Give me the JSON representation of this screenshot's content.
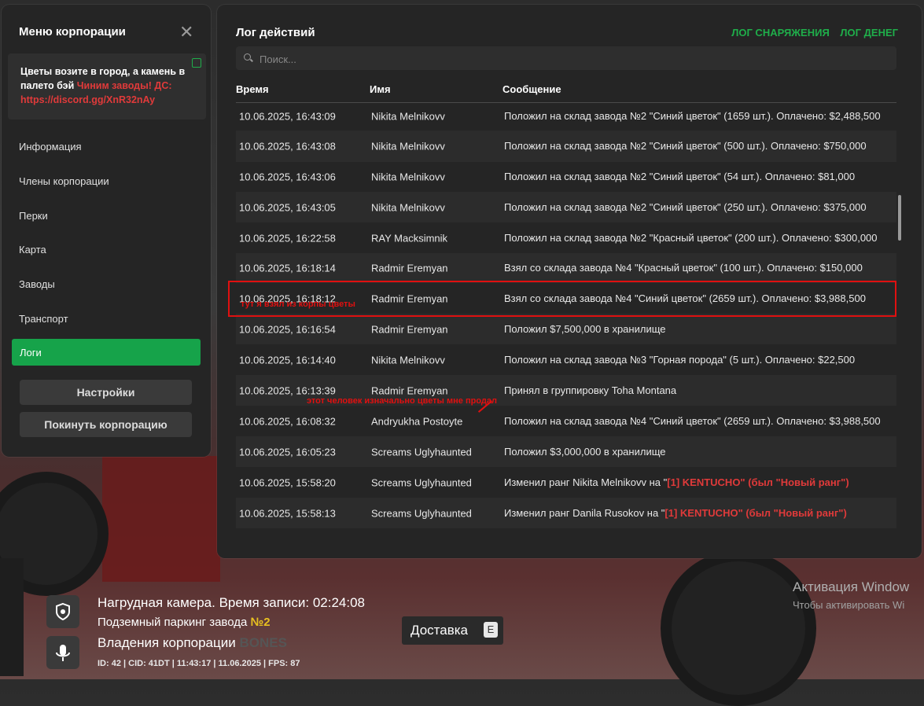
{
  "sidebar": {
    "title": "Меню корпорации",
    "notice": {
      "text": "Цветы возите в город, а камень в палето бэй",
      "red_text": "Чиним заводы! ДС: https://discord.gg/XnR32nAy"
    },
    "items": [
      {
        "label": "Информация"
      },
      {
        "label": "Члены корпорации"
      },
      {
        "label": "Перки"
      },
      {
        "label": "Карта"
      },
      {
        "label": "Заводы"
      },
      {
        "label": "Транспорт"
      },
      {
        "label": "Логи"
      }
    ],
    "settings_label": "Настройки",
    "leave_label": "Покинуть корпорацию"
  },
  "log": {
    "title": "Лог действий",
    "tabs": [
      "ЛОГ СНАРЯЖЕНИЯ",
      "ЛОГ ДЕНЕГ"
    ],
    "search_placeholder": "Поиск...",
    "columns": [
      "Время",
      "Имя",
      "Сообщение"
    ],
    "rows": [
      {
        "time": "10.06.2025, 16:43:09",
        "name": "Nikita Melnikovv",
        "message": "Положил на склад завода №2 \"Синий цветок\" (1659 шт.). Оплачено: $2,488,500"
      },
      {
        "time": "10.06.2025, 16:43:08",
        "name": "Nikita Melnikovv",
        "message": "Положил на склад завода №2 \"Синий цветок\" (500 шт.). Оплачено: $750,000"
      },
      {
        "time": "10.06.2025, 16:43:06",
        "name": "Nikita Melnikovv",
        "message": "Положил на склад завода №2 \"Синий цветок\" (54 шт.). Оплачено: $81,000"
      },
      {
        "time": "10.06.2025, 16:43:05",
        "name": "Nikita Melnikovv",
        "message": "Положил на склад завода №2 \"Синий цветок\" (250 шт.). Оплачено: $375,000"
      },
      {
        "time": "10.06.2025, 16:22:58",
        "name": "RAY Macksimnik",
        "message": "Положил на склад завода №2 \"Красный цветок\" (200 шт.). Оплачено: $300,000"
      },
      {
        "time": "10.06.2025, 16:18:14",
        "name": "Radmir Eremyan",
        "message": "Взял со склада завода №4 \"Красный цветок\" (100 шт.). Оплачено: $150,000"
      },
      {
        "time": "10.06.2025, 16:18:12",
        "name": "Radmir Eremyan",
        "message": "Взял со склада завода №4 \"Синий цветок\" (2659 шт.). Оплачено: $3,988,500"
      },
      {
        "time": "10.06.2025, 16:16:54",
        "name": "Radmir Eremyan",
        "message": "Положил $7,500,000 в хранилище"
      },
      {
        "time": "10.06.2025, 16:14:40",
        "name": "Nikita Melnikovv",
        "message": "Положил на склад завода №3 \"Горная порода\" (5 шт.). Оплачено: $22,500"
      },
      {
        "time": "10.06.2025, 16:13:39",
        "name": "Radmir Eremyan",
        "message": "Принял в группировку Toha Montana"
      },
      {
        "time": "10.06.2025, 16:08:32",
        "name": "Andryukha Postoyte",
        "message": "Положил на склад завода №4 \"Синий цветок\" (2659 шт.). Оплачено: $3,988,500"
      },
      {
        "time": "10.06.2025, 16:05:23",
        "name": "Screams Uglyhaunted",
        "message": "Положил $3,000,000 в хранилище"
      },
      {
        "time": "10.06.2025, 15:58:20",
        "name": "Screams Uglyhaunted",
        "message": "Изменил ранг Nikita Melnikovv на \"",
        "message_red": "[1] KENTUCHO\" (был \"Новый ранг\")"
      },
      {
        "time": "10.06.2025, 15:58:13",
        "name": "Screams Uglyhaunted",
        "message": "Изменил ранг Danila Rusokov на \"",
        "message_red": "[1] KENTUCHO\" (был \"Новый ранг\")"
      }
    ]
  },
  "annotations": {
    "took": "тут я взял из корпы цветы",
    "seller": "этот человек изначально цветы мне продал"
  },
  "hud": {
    "bodycam": "Нагрудная камера. Время записи: 02:24:08",
    "location": "Подземный паркинг завода ",
    "location_num": "№2",
    "ownership": "Владения корпорации ",
    "corp": "BONES",
    "status": "ID: 42 | CID: 41DT | 11:43:17   | 11.06.2025 | FPS: 87",
    "delivery": "Доставка",
    "delivery_key": "E"
  },
  "windows": {
    "line1": "Активация Window",
    "line2": "Чтобы активировать Wi"
  },
  "colors": {
    "accent": "#16a34a",
    "alert": "#e03a3a",
    "annotation": "#e01010"
  }
}
